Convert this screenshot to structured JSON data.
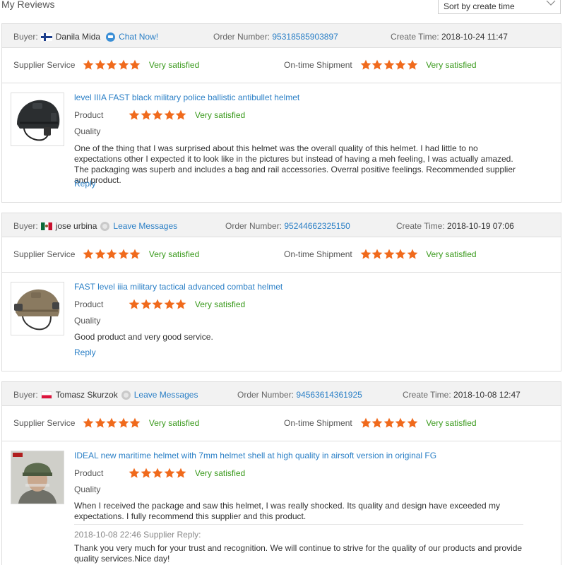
{
  "page": {
    "title": "My Reviews",
    "sort_label": "Sort by create time"
  },
  "labels": {
    "buyer": "Buyer:",
    "order_number": "Order Number:",
    "create_time": "Create Time:",
    "supplier_service": "Supplier Service",
    "ontime_shipment": "On-time Shipment",
    "product": "Product",
    "quality": "Quality",
    "reply": "Reply",
    "rating_text": "Very satisfied"
  },
  "reviews": [
    {
      "buyer": "Danila Mida",
      "contact_label": "Chat Now!",
      "order_number": "95318585903897",
      "create_time": "2018-10-24 11:47",
      "product_title": "level IIIA FAST black military police ballistic antibullet helmet",
      "text": "One of the thing that I was surprised about this helmet was the overall quality of this helmet. I had little to no expectations other I expected it to look like in the pictures but instead of having a meh feeling, I was actually amazed. The packaging was superb and includes a bag and rail accessories. Overral positive feelings. Recommended supplier and product."
    },
    {
      "buyer": "jose urbina",
      "contact_label": "Leave Messages",
      "order_number": "95244662325150",
      "create_time": "2018-10-19 07:06",
      "product_title": "FAST level iiia military tactical advanced combat helmet",
      "text": "Good product and very good service."
    },
    {
      "buyer": "Tomasz Skurzok",
      "contact_label": "Leave Messages",
      "order_number": "94563614361925",
      "create_time": "2018-10-08 12:47",
      "product_title": "IDEAL new maritime helmet with 7mm helmet shell at high quality in airsoft version in original FG",
      "text": "When I received the package and saw this helmet, I was really shocked. Its quality and design have exceeded my expectations. I fully recommend this supplier and this product.",
      "supplier_reply_meta": "2018-10-08 22:46  Supplier Reply:",
      "supplier_reply_text": "Thank you very much for your trust and recognition. We will continue to strive for the quality of our products and provide quality services.Nice day!"
    }
  ],
  "ratings": {
    "stars": 5,
    "max": 5
  },
  "colors": {
    "link": "#2a7fc6",
    "star": "#f06a1c",
    "satisfied": "#3a9a1c",
    "header_bg": "#f2f2f2"
  },
  "icons": [
    "chevron-down-icon",
    "chat-icon",
    "message-icon",
    "star-icon",
    "flag-finland-icon",
    "flag-mexico-icon",
    "flag-poland-icon"
  ]
}
